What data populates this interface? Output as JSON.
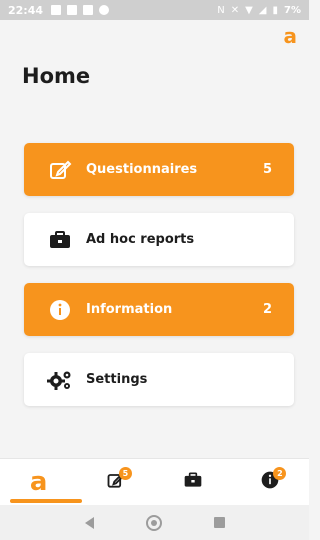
{
  "status_bar": {
    "time": "22:44",
    "battery": "7%",
    "icons_left": [
      "image-icon",
      "message-icon",
      "square-icon",
      "facebook-icon"
    ],
    "icons_right": [
      "nfc-icon",
      "mute-icon",
      "wifi-icon",
      "signal-icon",
      "battery-icon"
    ]
  },
  "brand": {
    "logo_text": "a",
    "accent_color": "#f7941d"
  },
  "page": {
    "title": "Home"
  },
  "menu": {
    "items": [
      {
        "label": "Questionnaires",
        "count": "5",
        "icon": "edit-icon",
        "style": "orange"
      },
      {
        "label": "Ad hoc reports",
        "count": "",
        "icon": "briefcase-icon",
        "style": "white"
      },
      {
        "label": "Information",
        "count": "2",
        "icon": "info-icon",
        "style": "orange"
      },
      {
        "label": "Settings",
        "count": "",
        "icon": "gears-icon",
        "style": "white"
      }
    ]
  },
  "bottom_nav": {
    "items": [
      {
        "name": "home",
        "icon": "logo-icon",
        "badge": "",
        "active": true
      },
      {
        "name": "questionnaires",
        "icon": "edit-icon",
        "badge": "5",
        "active": false
      },
      {
        "name": "reports",
        "icon": "briefcase-icon",
        "badge": "",
        "active": false
      },
      {
        "name": "information",
        "icon": "info-icon",
        "badge": "2",
        "active": false
      }
    ]
  }
}
